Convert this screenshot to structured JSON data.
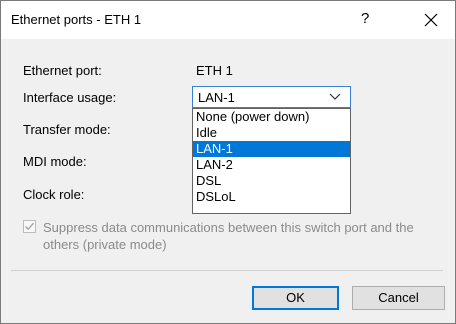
{
  "window": {
    "title": "Ethernet ports - ETH 1",
    "help_label": "?"
  },
  "form": {
    "ethernet_port_label": "Ethernet port:",
    "ethernet_port_value": "ETH 1",
    "interface_usage_label": "Interface usage:",
    "interface_usage_value": "LAN-1",
    "transfer_mode_label": "Transfer mode:",
    "mdi_mode_label": "MDI mode:",
    "clock_role_label": "Clock role:"
  },
  "dropdown": {
    "options": [
      "None (power down)",
      "Idle",
      "LAN-1",
      "LAN-2",
      "DSL",
      "DSLoL"
    ],
    "selected": "LAN-1"
  },
  "suppress_checkbox": {
    "label": "Suppress data communications between this switch port and the others (private mode)",
    "checked": true,
    "enabled": false
  },
  "buttons": {
    "ok": "OK",
    "cancel": "Cancel"
  },
  "colors": {
    "selection": "#0078d7",
    "focus_border": "#3a7fd6"
  }
}
